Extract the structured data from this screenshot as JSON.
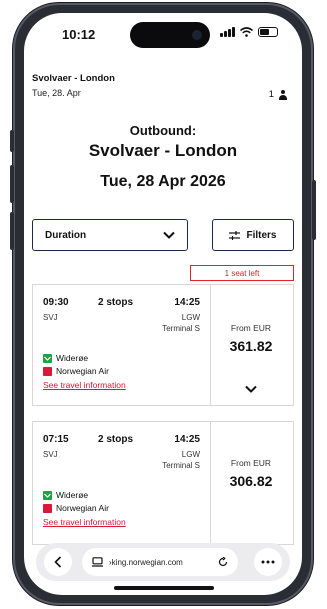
{
  "status_bar": {
    "time": "10:12"
  },
  "trip_summary": {
    "route": "Svolvaer - London",
    "date": "Tue, 28. Apr",
    "passengers": "1"
  },
  "header": {
    "direction": "Outbound:",
    "route": "Svolvaer - London",
    "date": "Tue, 28 Apr 2026"
  },
  "controls": {
    "sort_label": "Duration",
    "filters_label": "Filters"
  },
  "badge": {
    "seats_left": "1 seat left"
  },
  "flights": [
    {
      "departure_time": "09:30",
      "stops": "2 stops",
      "arrival_time": "14:25",
      "departure_code": "SVJ",
      "arrival_code": "LGW",
      "terminal": "Terminal S",
      "airlines": [
        "Widerøe",
        "Norwegian Air"
      ],
      "info_link": "See travel information",
      "price_prefix": "From EUR",
      "price": "361.82"
    },
    {
      "departure_time": "07:15",
      "stops": "2 stops",
      "arrival_time": "14:25",
      "departure_code": "SVJ",
      "arrival_code": "LGW",
      "terminal": "Terminal S",
      "airlines": [
        "Widerøe",
        "Norwegian Air"
      ],
      "info_link": "See travel information",
      "price_prefix": "From EUR",
      "price": "306.82"
    }
  ],
  "browser": {
    "url": "›king.norwegian.com"
  },
  "colors": {
    "accent_red": "#d81939",
    "widerøe_green": "#1da245",
    "border_navy": "#1a2a4a"
  }
}
